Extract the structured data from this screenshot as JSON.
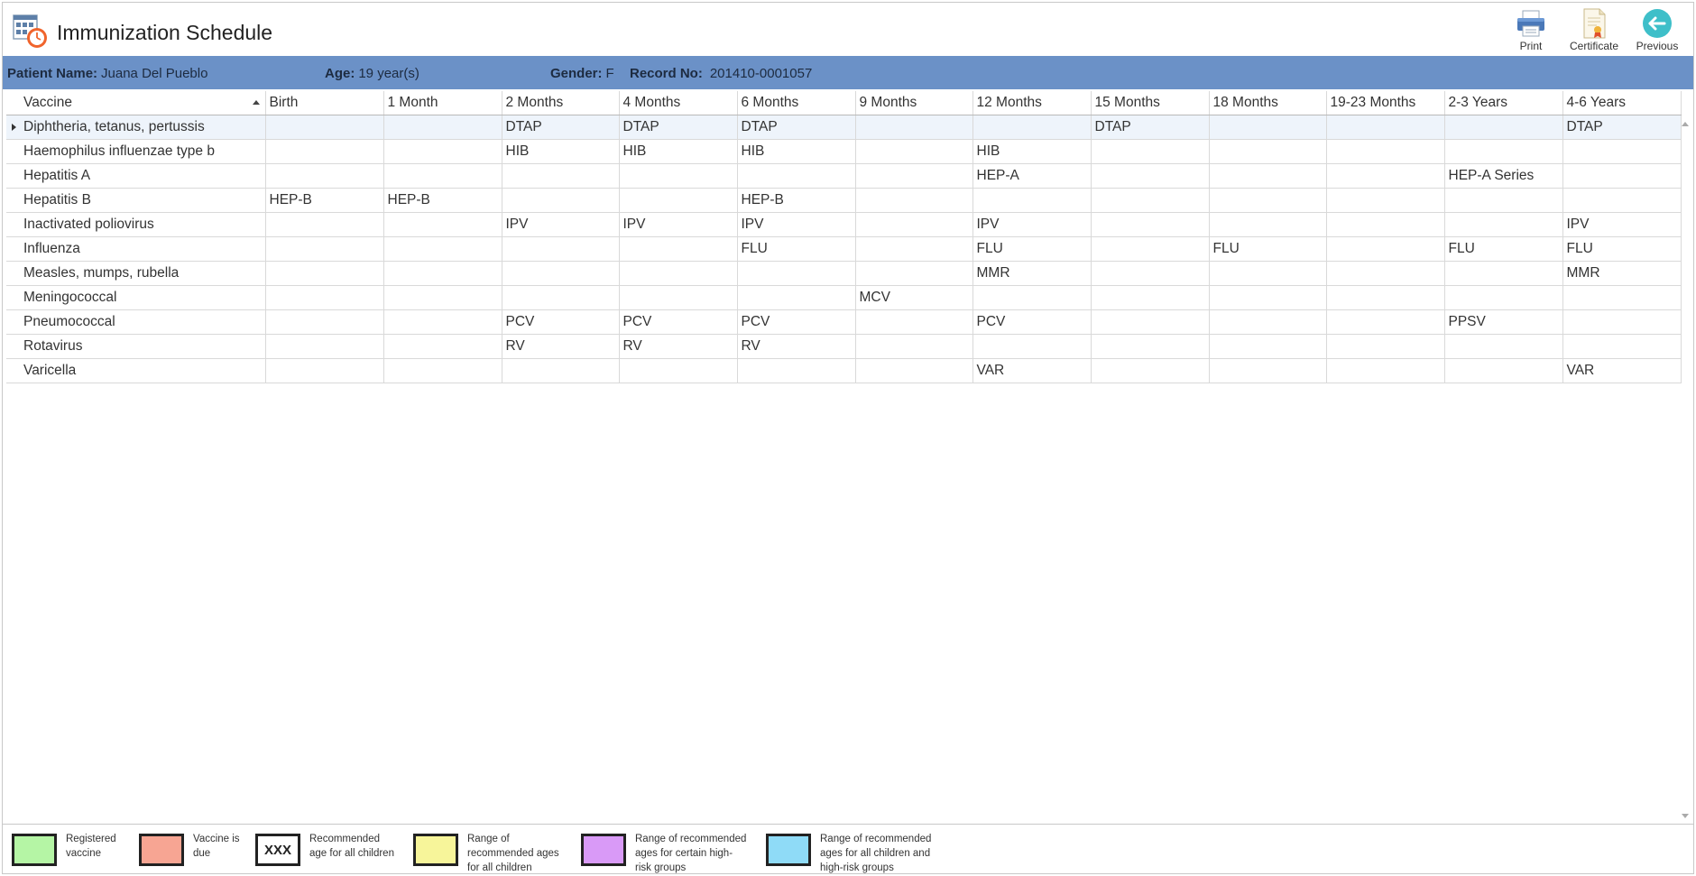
{
  "header": {
    "title": "Immunization Schedule",
    "toolbar": [
      {
        "label": "Print",
        "icon": "printer-icon"
      },
      {
        "label": "Certificate",
        "icon": "certificate-icon"
      },
      {
        "label": "Previous",
        "icon": "back-arrow-icon"
      }
    ]
  },
  "patient": {
    "name_label": "Patient Name:",
    "name": "Juana Del Pueblo",
    "age_label": "Age:",
    "age": "19 year(s)",
    "gender_label": "Gender:",
    "gender": "F",
    "record_label": "Record No:",
    "record": "201410-0001057"
  },
  "grid": {
    "columns": [
      "Vaccine",
      "Birth",
      "1 Month",
      "2 Months",
      "4 Months",
      "6 Months",
      "9 Months",
      "12 Months",
      "15 Months",
      "18 Months",
      "19-23 Months",
      "2-3 Years",
      "4-6 Years"
    ],
    "rows": [
      [
        "Diphtheria, tetanus, pertussis",
        "",
        "",
        "DTAP",
        "DTAP",
        "DTAP",
        "",
        "",
        "DTAP",
        "",
        "",
        "",
        "DTAP"
      ],
      [
        "Haemophilus influenzae type b",
        "",
        "",
        "HIB",
        "HIB",
        "HIB",
        "",
        "HIB",
        "",
        "",
        "",
        "",
        ""
      ],
      [
        "Hepatitis A",
        "",
        "",
        "",
        "",
        "",
        "",
        "HEP-A",
        "",
        "",
        "",
        "HEP-A Series",
        ""
      ],
      [
        "Hepatitis B",
        "HEP-B",
        "HEP-B",
        "",
        "",
        "HEP-B",
        "",
        "",
        "",
        "",
        "",
        "",
        ""
      ],
      [
        "Inactivated poliovirus",
        "",
        "",
        "IPV",
        "IPV",
        "IPV",
        "",
        "IPV",
        "",
        "",
        "",
        "",
        "IPV"
      ],
      [
        "Influenza",
        "",
        "",
        "",
        "",
        "FLU",
        "",
        "FLU",
        "",
        "FLU",
        "",
        "FLU",
        "FLU"
      ],
      [
        "Measles, mumps, rubella",
        "",
        "",
        "",
        "",
        "",
        "",
        "MMR",
        "",
        "",
        "",
        "",
        "MMR"
      ],
      [
        "Meningococcal",
        "",
        "",
        "",
        "",
        "",
        "MCV",
        "",
        "",
        "",
        "",
        "",
        ""
      ],
      [
        "Pneumococcal",
        "",
        "",
        "PCV",
        "PCV",
        "PCV",
        "",
        "PCV",
        "",
        "",
        "",
        "PPSV",
        ""
      ],
      [
        "Rotavirus",
        "",
        "",
        "RV",
        "RV",
        "RV",
        "",
        "",
        "",
        "",
        "",
        "",
        ""
      ],
      [
        "Varicella",
        "",
        "",
        "",
        "",
        "",
        "",
        "VAR",
        "",
        "",
        "",
        "",
        "VAR"
      ]
    ]
  },
  "legend": [
    {
      "color": "#b5f5a5",
      "swatch_text": "",
      "text": [
        "Registered",
        "vaccine"
      ]
    },
    {
      "color": "#f7a593",
      "swatch_text": "",
      "text": [
        "Vaccine is",
        "due"
      ]
    },
    {
      "color": "#ffffff",
      "swatch_text": "XXX",
      "text": [
        "Recommended",
        "age for all children"
      ]
    },
    {
      "color": "#f7f59a",
      "swatch_text": "",
      "text": [
        "Range of",
        "recommended ages",
        "for all children"
      ]
    },
    {
      "color": "#d99af7",
      "swatch_text": "",
      "text": [
        "Range of recommended",
        "ages for certain high-",
        "risk groups"
      ]
    },
    {
      "color": "#8fdbf7",
      "swatch_text": "",
      "text": [
        "Range of recommended",
        "ages for all children and",
        "high-risk groups"
      ]
    }
  ]
}
